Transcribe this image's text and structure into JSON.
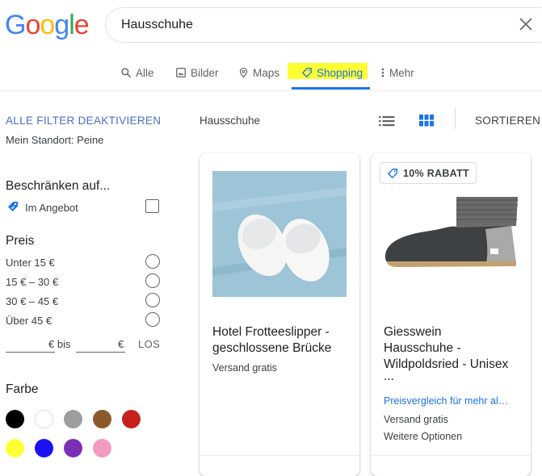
{
  "search": {
    "query": "Hausschuhe"
  },
  "logo": {
    "letters": [
      "G",
      "o",
      "o",
      "g",
      "l",
      "e"
    ],
    "colors": [
      "#4285F4",
      "#EA4335",
      "#FBBC05",
      "#4285F4",
      "#34A853",
      "#EA4335"
    ]
  },
  "tabs": [
    {
      "label": "Alle",
      "icon": "search-icon"
    },
    {
      "label": "Bilder",
      "icon": "image-icon"
    },
    {
      "label": "Maps",
      "icon": "map-pin-icon"
    },
    {
      "label": "Shopping",
      "icon": "tag-icon",
      "active": true
    },
    {
      "label": "Mehr",
      "icon": "more-vert-icon"
    }
  ],
  "filters": {
    "reset_label": "ALLE FILTER DEAKTIVIEREN",
    "location": "Mein Standort: Peine",
    "restrict": {
      "title": "Beschränken auf...",
      "option": "Im Angebot"
    },
    "price": {
      "title": "Preis",
      "options": [
        "Unter 15 €",
        "15 € – 30 €",
        "30 € – 45 €",
        "Über 45 €"
      ],
      "from_suffix": "€ bis",
      "to_suffix": "€",
      "go_label": "LOS"
    },
    "color": {
      "title": "Farbe",
      "swatches": [
        "#000000",
        "#ffffff",
        "#9e9e9e",
        "#8b5a2b",
        "#c5221f",
        "#ffff33",
        "#1a12f0",
        "#7b2fb5",
        "#f19ac2"
      ]
    }
  },
  "results": {
    "query_label": "Hausschuhe",
    "sort_label": "SORTIEREN",
    "view_icons": [
      "list-view-icon",
      "grid-view-icon"
    ],
    "accent_color": "#1a73e8"
  },
  "products": [
    {
      "title_lines": [
        "Hotel Frotteeslipper -",
        "geschlossene Brücke"
      ],
      "shipping": "Versand gratis"
    },
    {
      "badge": "10% RABATT",
      "title_lines": [
        "Giesswein",
        "Hausschuhe -",
        "Wildpoldsried - Unisex",
        "..."
      ],
      "compare_link": "Preisvergleich für mehr al…",
      "shipping": "Versand gratis",
      "more_options": "Weitere Optionen"
    }
  ]
}
